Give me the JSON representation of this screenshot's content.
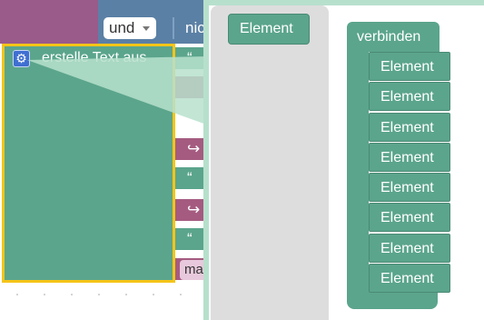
{
  "workspace": {
    "logic_block": {
      "dropdown_value": "und",
      "next_label": "nic"
    },
    "create_text_block": {
      "label": "erstelle Text aus"
    },
    "input_glyphs": {
      "quote": "“",
      "arrow": "↪"
    },
    "value_chip": "ma"
  },
  "mutator": {
    "flyout": {
      "item_label": "Element"
    },
    "join_block": {
      "label": "verbinden",
      "items": [
        "Element",
        "Element",
        "Element",
        "Element",
        "Element",
        "Element",
        "Element",
        "Element"
      ]
    }
  },
  "colors": {
    "text_block": "#5ba58c",
    "logic_block": "#5b80a5",
    "list_block": "#a55b80",
    "selection": "#f5c518"
  },
  "icons": {
    "mutator": "gear-icon",
    "dropdown": "triangle-down-icon"
  }
}
